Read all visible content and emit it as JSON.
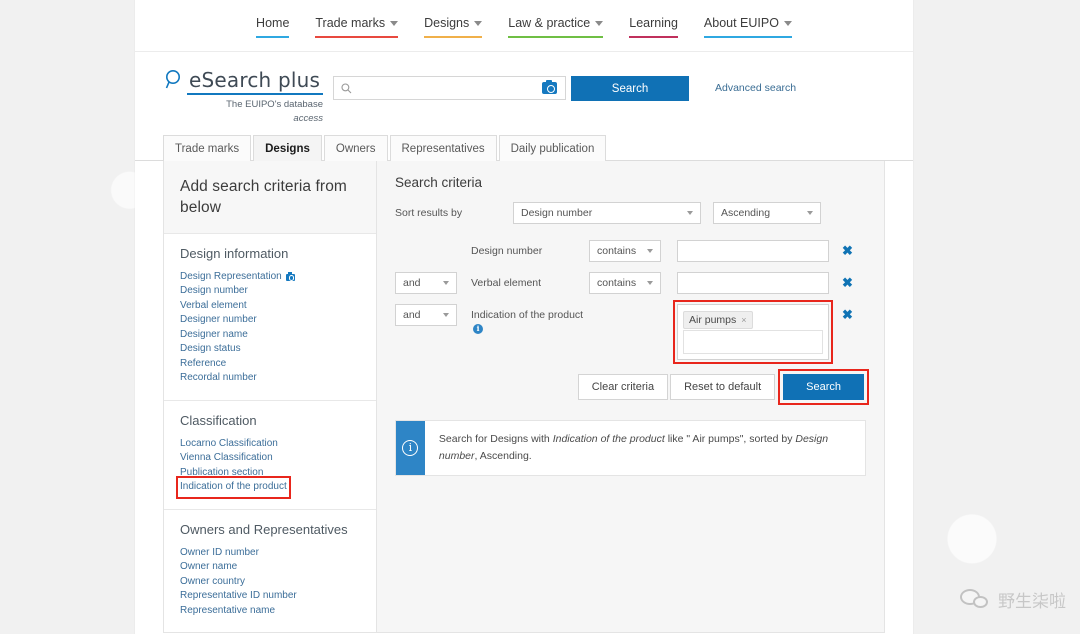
{
  "topnav": {
    "items": [
      {
        "label": "Home",
        "caret": false,
        "underline": "#2fa8e1"
      },
      {
        "label": "Trade marks",
        "caret": true,
        "underline": "#e8493f"
      },
      {
        "label": "Designs",
        "caret": true,
        "underline": "#f0b04a"
      },
      {
        "label": "Law & practice",
        "caret": true,
        "underline": "#6fbf44"
      },
      {
        "label": "Learning",
        "caret": false,
        "underline": "#c0305c"
      },
      {
        "label": "About EUIPO",
        "caret": true,
        "underline": "#2fa8e1"
      }
    ]
  },
  "brand": {
    "logo_text": "eSearch plus",
    "tagline_line1": "The EUIPO's database",
    "tagline_line2": "access",
    "search_placeholder": "",
    "search_value": "",
    "search_icon": "magnifier-icon",
    "camera_icon": "camera-icon",
    "search_button": "Search",
    "advanced_link": "Advanced search"
  },
  "tabs": [
    {
      "label": "Trade marks",
      "active": false
    },
    {
      "label": "Designs",
      "active": true
    },
    {
      "label": "Owners",
      "active": false
    },
    {
      "label": "Representatives",
      "active": false
    },
    {
      "label": "Daily publication",
      "active": false
    }
  ],
  "sidebar": {
    "heading": "Add search criteria from below",
    "sections": [
      {
        "title": "Design information",
        "links": [
          {
            "label": "Design Representation",
            "icon": "camera-icon",
            "highlight": false
          },
          {
            "label": "Design number",
            "icon": null,
            "highlight": false
          },
          {
            "label": "Verbal element",
            "icon": null,
            "highlight": false
          },
          {
            "label": "Designer number",
            "icon": null,
            "highlight": false
          },
          {
            "label": "Designer name",
            "icon": null,
            "highlight": false
          },
          {
            "label": "Design status",
            "icon": null,
            "highlight": false
          },
          {
            "label": "Reference",
            "icon": null,
            "highlight": false
          },
          {
            "label": "Recordal number",
            "icon": null,
            "highlight": false
          }
        ]
      },
      {
        "title": "Classification",
        "links": [
          {
            "label": "Locarno Classification",
            "icon": null,
            "highlight": false
          },
          {
            "label": "Vienna Classification",
            "icon": null,
            "highlight": false
          },
          {
            "label": "Publication section",
            "icon": null,
            "highlight": false
          },
          {
            "label": "Indication of the product",
            "icon": null,
            "highlight": true
          }
        ]
      },
      {
        "title": "Owners and Representatives",
        "links": [
          {
            "label": "Owner ID number",
            "icon": null,
            "highlight": false
          },
          {
            "label": "Owner name",
            "icon": null,
            "highlight": false
          },
          {
            "label": "Owner country",
            "icon": null,
            "highlight": false
          },
          {
            "label": "Representative ID number",
            "icon": null,
            "highlight": false
          },
          {
            "label": "Representative name",
            "icon": null,
            "highlight": false
          }
        ]
      }
    ]
  },
  "main": {
    "title": "Search criteria",
    "sort": {
      "label": "Sort results by",
      "field_value": "Design number",
      "direction_value": "Ascending"
    },
    "criteria": [
      {
        "conjunction": null,
        "field": "Design number",
        "info_icon": false,
        "operator": "contains",
        "value": "",
        "type": "text",
        "highlight": false,
        "delete_icon": "remove-criterion-icon"
      },
      {
        "conjunction": "and",
        "field": "Verbal element",
        "info_icon": false,
        "operator": "contains",
        "value": "",
        "type": "text",
        "highlight": false,
        "delete_icon": "remove-criterion-icon"
      },
      {
        "conjunction": "and",
        "field": "Indication of the product",
        "info_icon": true,
        "operator": null,
        "value": "",
        "type": "tags",
        "tags": [
          {
            "label": "Air pumps",
            "remove_icon": "chip-remove-icon"
          }
        ],
        "highlight": true,
        "delete_icon": "remove-criterion-icon"
      }
    ],
    "buttons": {
      "clear": "Clear criteria",
      "reset": "Reset to default",
      "search": "Search",
      "search_highlight": true
    },
    "info_banner": {
      "icon": "info-icon",
      "part1": "Search for Designs with ",
      "em1": "Indication of the product",
      "part2": " like \" Air pumps\", sorted by ",
      "em2": "Design number",
      "part3": ", Ascending."
    }
  },
  "watermark": {
    "icon": "wechat-icon",
    "text": "野生柒啦"
  }
}
